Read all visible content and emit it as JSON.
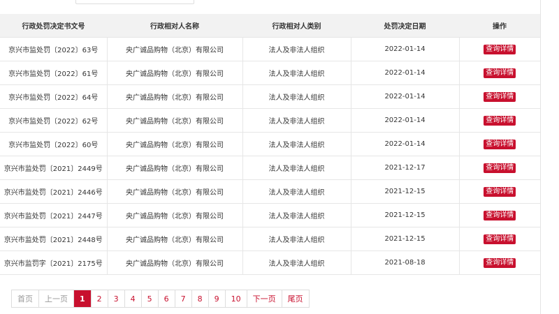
{
  "colors": {
    "accent": "#c8102e",
    "header_bg": "#f2f2f2",
    "border": "#e6e6e6"
  },
  "table": {
    "headers": [
      "行政处罚决定书文号",
      "行政相对人名称",
      "行政相对人类别",
      "处罚决定日期",
      "操作"
    ],
    "rows": [
      {
        "doc_no": "京兴市监处罚〔2022〕63号",
        "name": "央广诚品购物（北京）有限公司",
        "category": "法人及非法人组织",
        "date": "2022-01-14",
        "action": "查询详情"
      },
      {
        "doc_no": "京兴市监处罚〔2022〕61号",
        "name": "央广诚品购物（北京）有限公司",
        "category": "法人及非法人组织",
        "date": "2022-01-14",
        "action": "查询详情"
      },
      {
        "doc_no": "京兴市监处罚〔2022〕64号",
        "name": "央广诚品购物（北京）有限公司",
        "category": "法人及非法人组织",
        "date": "2022-01-14",
        "action": "查询详情"
      },
      {
        "doc_no": "京兴市监处罚〔2022〕62号",
        "name": "央广诚品购物（北京）有限公司",
        "category": "法人及非法人组织",
        "date": "2022-01-14",
        "action": "查询详情"
      },
      {
        "doc_no": "京兴市监处罚〔2022〕60号",
        "name": "央广诚品购物（北京）有限公司",
        "category": "法人及非法人组织",
        "date": "2022-01-14",
        "action": "查询详情"
      },
      {
        "doc_no": "京兴市监处罚〔2021〕2449号",
        "name": "央广诚品购物（北京）有限公司",
        "category": "法人及非法人组织",
        "date": "2021-12-17",
        "action": "查询详情"
      },
      {
        "doc_no": "京兴市监处罚〔2021〕2446号",
        "name": "央广诚品购物（北京）有限公司",
        "category": "法人及非法人组织",
        "date": "2021-12-15",
        "action": "查询详情"
      },
      {
        "doc_no": "京兴市监处罚〔2021〕2447号",
        "name": "央广诚品购物（北京）有限公司",
        "category": "法人及非法人组织",
        "date": "2021-12-15",
        "action": "查询详情"
      },
      {
        "doc_no": "京兴市监处罚〔2021〕2448号",
        "name": "央广诚品购物（北京）有限公司",
        "category": "法人及非法人组织",
        "date": "2021-12-15",
        "action": "查询详情"
      },
      {
        "doc_no": "京兴市监罚字〔2021〕2175号",
        "name": "央广诚品购物（北京）有限公司",
        "category": "法人及非法人组织",
        "date": "2021-08-18",
        "action": "查询详情"
      }
    ]
  },
  "pagination": {
    "first": "首页",
    "prev": "上一页",
    "pages": [
      "1",
      "2",
      "3",
      "4",
      "5",
      "6",
      "7",
      "8",
      "9",
      "10"
    ],
    "current": "1",
    "next": "下一页",
    "last": "尾页"
  }
}
